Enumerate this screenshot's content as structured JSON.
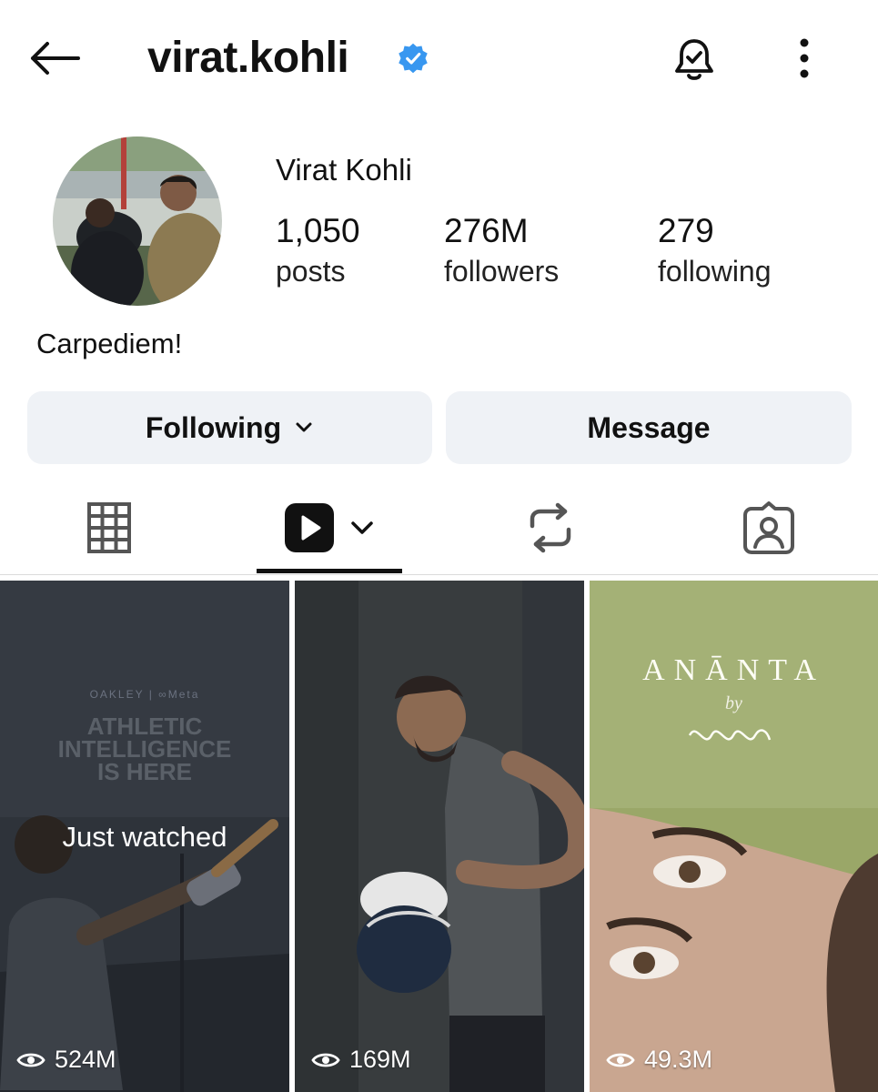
{
  "header": {
    "username": "virat.kohli",
    "icons": {
      "back": "arrow-left-icon",
      "verified": "verified-badge-icon",
      "notifications": "bell-check-icon",
      "more": "more-vertical-icon"
    }
  },
  "profile": {
    "display_name": "Virat Kohli",
    "bio": "Carpediem!",
    "stats": [
      {
        "value": "1,050",
        "label": "posts"
      },
      {
        "value": "276M",
        "label": "followers"
      },
      {
        "value": "279",
        "label": "following"
      }
    ]
  },
  "actions": {
    "following_label": "Following",
    "message_label": "Message"
  },
  "tabs": {
    "items": [
      {
        "icon": "grid-icon"
      },
      {
        "icon": "reels-icon",
        "active": true
      },
      {
        "icon": "repost-icon"
      },
      {
        "icon": "tagged-icon"
      }
    ]
  },
  "reels": [
    {
      "views": "524M",
      "overlay": "Just watched",
      "ad_brand": "OAKLEY  |  ∞Meta",
      "ad_text": "ATHLETIC\nINTELLIGENCE\nIS HERE"
    },
    {
      "views": "169M"
    },
    {
      "views": "49.3M",
      "title": "ANĀNTA",
      "by": "by"
    }
  ],
  "colors": {
    "verified": "#3897f0",
    "button_bg": "#eff2f6",
    "text": "#111111"
  }
}
